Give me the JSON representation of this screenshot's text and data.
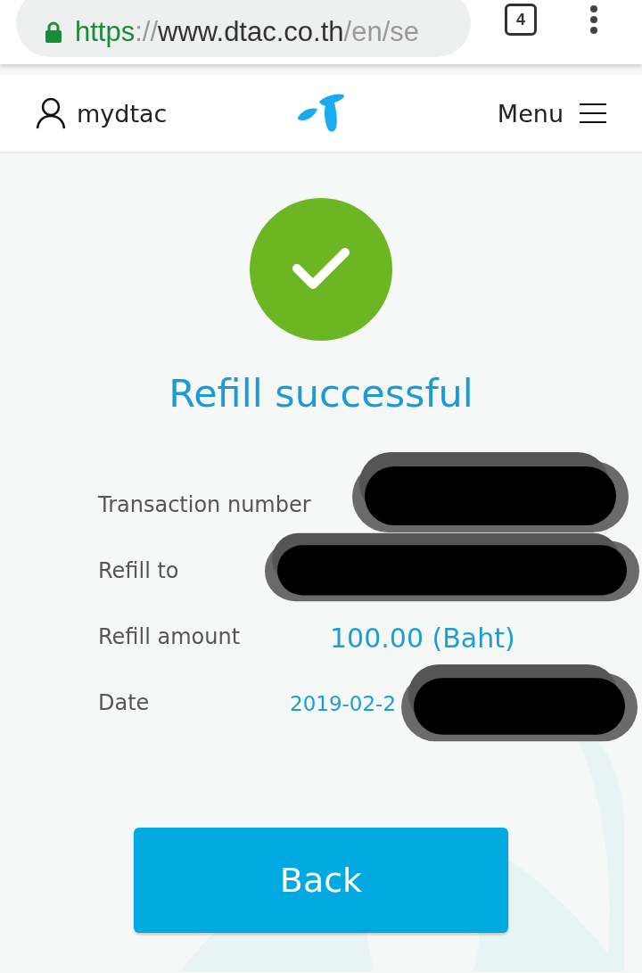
{
  "browser": {
    "url": {
      "scheme": "https",
      "separator": "://",
      "host": "www.dtac.co.th",
      "path": "/en/se"
    },
    "tab_count": "4",
    "secure": true
  },
  "header": {
    "account_label": "mydtac",
    "menu_label": "Menu"
  },
  "result": {
    "success": true,
    "title": "Refill successful"
  },
  "details": [
    {
      "label": "Transaction number",
      "redacted": true
    },
    {
      "label": "Refill to",
      "redacted": true
    },
    {
      "kind": "amount",
      "label": "Refill amount",
      "value": "100.00 (Baht)",
      "redacted": false
    },
    {
      "kind": "date",
      "label": "Date",
      "value": "2019-02-2",
      "redacted": true
    }
  ],
  "buttons": [
    {
      "label": "Back"
    }
  ]
}
